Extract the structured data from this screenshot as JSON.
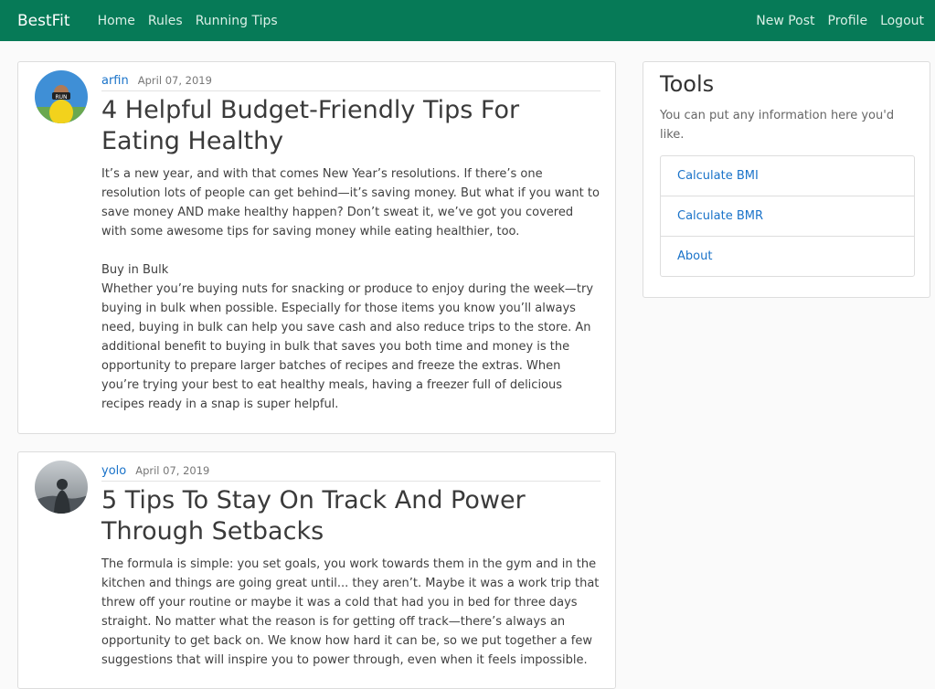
{
  "nav": {
    "brand": "BestFit",
    "left": [
      "Home",
      "Rules",
      "Running Tips"
    ],
    "right": [
      "New Post",
      "Profile",
      "Logout"
    ]
  },
  "posts": [
    {
      "author": "arfin",
      "date": "April 07, 2019",
      "title": "4 Helpful Budget-Friendly Tips For Eating Healthy",
      "paragraphs": [
        "It’s a new year, and with that comes New Year’s resolutions. If there’s one resolution lots of people can get behind—it’s saving money. But what if you want to save money AND make healthy happen? Don’t sweat it, we’ve got you covered with some awesome tips for saving money while eating healthier, too.",
        "Buy in Bulk\nWhether you’re buying nuts for snacking or produce to enjoy during the week—try buying in bulk when possible. Especially for those items you know you’ll always need, buying in bulk can help you save cash and also reduce trips to the store. An additional benefit to buying in bulk that saves you both time and money is the opportunity to prepare larger batches of recipes and freeze the extras. When you’re trying your best to eat healthy meals, having a freezer full of delicious recipes ready in a snap is super helpful."
      ]
    },
    {
      "author": "yolo",
      "date": "April 07, 2019",
      "title": "5 Tips To Stay On Track And Power Through Setbacks",
      "paragraphs": [
        "The formula is simple: you set goals, you work towards them in the gym and in the kitchen and things are going great until... they aren’t. Maybe it was a work trip that threw off your routine or maybe it was a cold that had you in bed for three days straight. No matter what the reason is for getting off track—there’s always an opportunity to get back on. We know how hard it can be, so we put together a few suggestions that will inspire you to power through, even when it feels impossible."
      ]
    }
  ],
  "sidebar": {
    "title": "Tools",
    "description": "You can put any information here you'd like.",
    "links": [
      "Calculate BMI",
      "Calculate BMR",
      "About"
    ]
  },
  "colors": {
    "navbar": "#067a57",
    "link": "#1a73c9"
  }
}
